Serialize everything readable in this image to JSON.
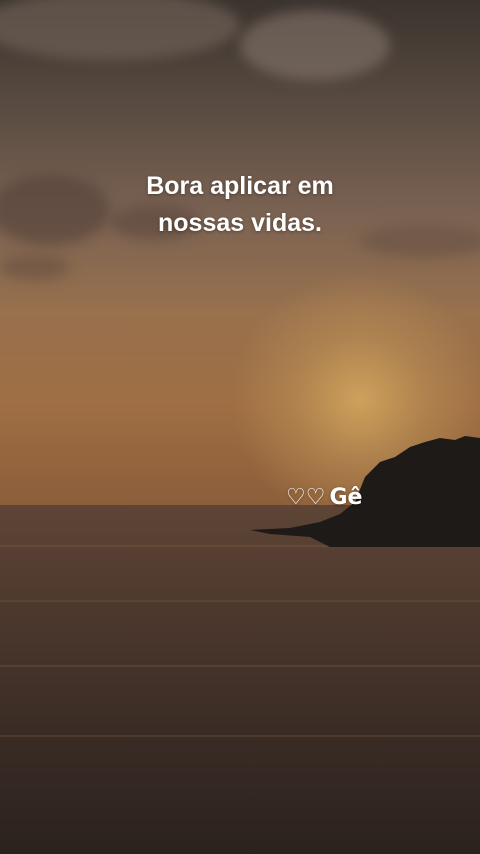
{
  "overlay": {
    "quote_line1": "Bora aplicar em",
    "quote_line2": "nossas vidas.",
    "signature_hearts": "♡♡",
    "signature_name": "Gê"
  },
  "colors": {
    "text": "#ffffff",
    "sky": "#98714d",
    "sea": "#3a2c25",
    "island": "#1e1a17"
  },
  "scene": {
    "subject": "sunset-over-sea"
  }
}
